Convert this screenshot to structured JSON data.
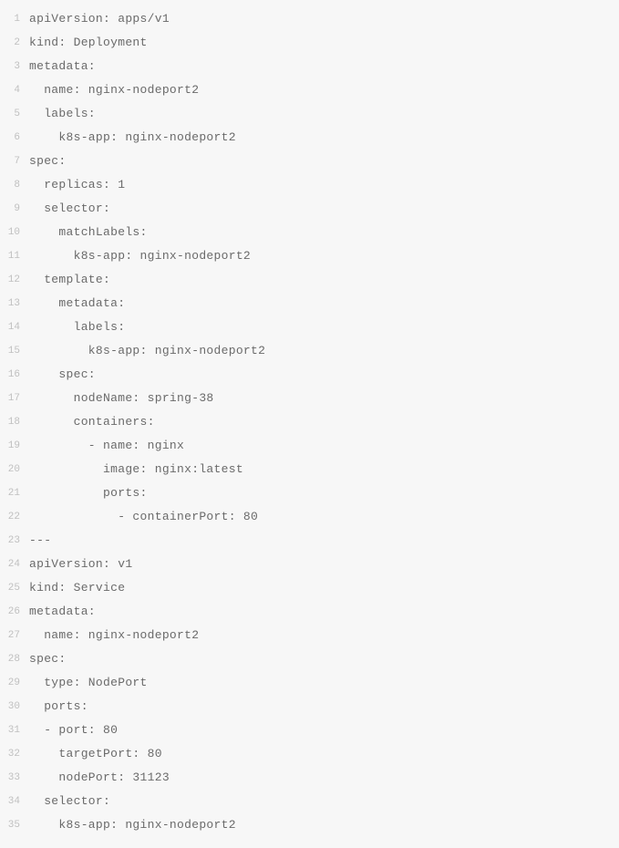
{
  "lines": [
    {
      "num": "1",
      "text": "apiVersion: apps/v1"
    },
    {
      "num": "2",
      "text": "kind: Deployment"
    },
    {
      "num": "3",
      "text": "metadata:"
    },
    {
      "num": "4",
      "text": "  name: nginx-nodeport2"
    },
    {
      "num": "5",
      "text": "  labels:"
    },
    {
      "num": "6",
      "text": "    k8s-app: nginx-nodeport2"
    },
    {
      "num": "7",
      "text": "spec:"
    },
    {
      "num": "8",
      "text": "  replicas: 1"
    },
    {
      "num": "9",
      "text": "  selector:"
    },
    {
      "num": "10",
      "text": "    matchLabels:"
    },
    {
      "num": "11",
      "text": "      k8s-app: nginx-nodeport2"
    },
    {
      "num": "12",
      "text": "  template:"
    },
    {
      "num": "13",
      "text": "    metadata:"
    },
    {
      "num": "14",
      "text": "      labels:"
    },
    {
      "num": "15",
      "text": "        k8s-app: nginx-nodeport2"
    },
    {
      "num": "16",
      "text": "    spec:"
    },
    {
      "num": "17",
      "text": "      nodeName: spring-38"
    },
    {
      "num": "18",
      "text": "      containers:"
    },
    {
      "num": "19",
      "text": "        - name: nginx"
    },
    {
      "num": "20",
      "text": "          image: nginx:latest"
    },
    {
      "num": "21",
      "text": "          ports:"
    },
    {
      "num": "22",
      "text": "            - containerPort: 80"
    },
    {
      "num": "23",
      "text": "---"
    },
    {
      "num": "24",
      "text": "apiVersion: v1"
    },
    {
      "num": "25",
      "text": "kind: Service"
    },
    {
      "num": "26",
      "text": "metadata:"
    },
    {
      "num": "27",
      "text": "  name: nginx-nodeport2"
    },
    {
      "num": "28",
      "text": "spec:"
    },
    {
      "num": "29",
      "text": "  type: NodePort"
    },
    {
      "num": "30",
      "text": "  ports:"
    },
    {
      "num": "31",
      "text": "  - port: 80"
    },
    {
      "num": "32",
      "text": "    targetPort: 80"
    },
    {
      "num": "33",
      "text": "    nodePort: 31123"
    },
    {
      "num": "34",
      "text": "  selector:"
    },
    {
      "num": "35",
      "text": "    k8s-app: nginx-nodeport2"
    }
  ]
}
